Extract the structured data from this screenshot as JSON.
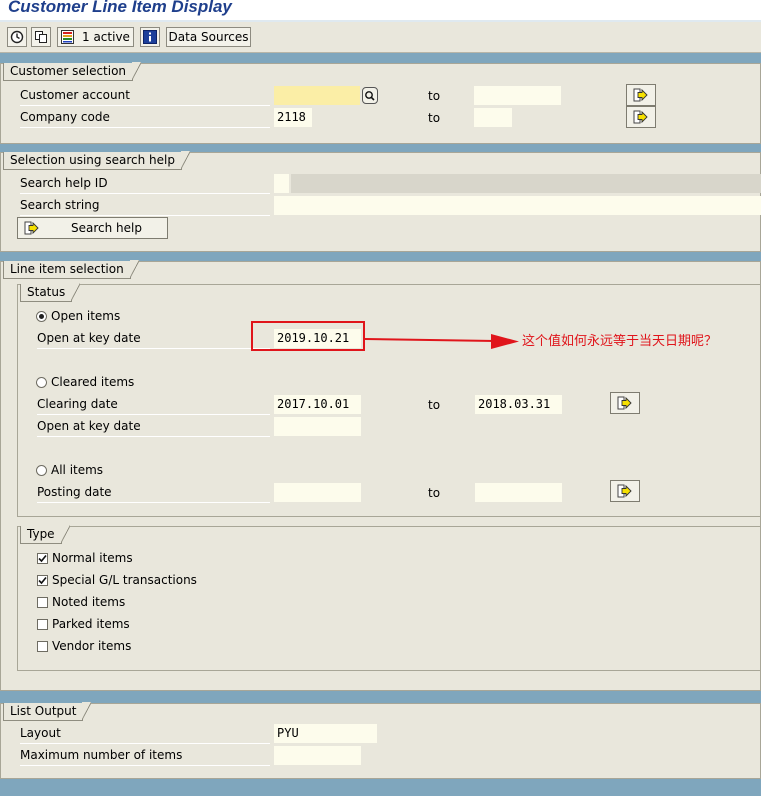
{
  "window": {
    "title": "Customer Line Item Display"
  },
  "toolbar": {
    "execute_icon": "clock-execute-icon",
    "variant_icon": "copy-variant-icon",
    "dynamic_selections_label": "1  active",
    "info_icon": "info-icon",
    "data_sources_label": "Data Sources"
  },
  "customer_selection": {
    "title": "Customer selection",
    "customer_account_label": "Customer account",
    "customer_account_value": "",
    "to_label": "to",
    "customer_account_to": "",
    "company_code_label": "Company code",
    "company_code_value": "2118",
    "company_code_to": ""
  },
  "search_help": {
    "title": "Selection using search help",
    "search_help_id_label": "Search help ID",
    "search_string_label": "Search string",
    "button_label": "Search help"
  },
  "line_item_selection": {
    "title": "Line item selection",
    "status": {
      "title": "Status",
      "open_items_label": "Open items",
      "open_at_key_date_label": "Open at key date",
      "open_at_key_date_value": "2019.10.21",
      "cleared_items_label": "Cleared items",
      "clearing_date_label": "Clearing date",
      "clearing_date_from": "2017.10.01",
      "to_label": "to",
      "clearing_date_to": "2018.03.31",
      "cleared_open_at_key_date_label": "Open at key date",
      "cleared_open_at_key_date_value": "",
      "all_items_label": "All items",
      "posting_date_label": "Posting date",
      "posting_date_from": "",
      "posting_date_to": "",
      "selected": "open_items"
    },
    "type": {
      "title": "Type",
      "items": [
        {
          "label": "Normal items",
          "checked": true
        },
        {
          "label": "Special G/L transactions",
          "checked": true
        },
        {
          "label": "Noted items",
          "checked": false
        },
        {
          "label": "Parked items",
          "checked": false
        },
        {
          "label": "Vendor items",
          "checked": false
        }
      ]
    }
  },
  "list_output": {
    "title": "List Output",
    "layout_label": "Layout",
    "layout_value": "PYU",
    "max_items_label": "Maximum number of items",
    "max_items_value": ""
  },
  "annotation": {
    "text": "这个值如何永远等于当天日期呢？",
    "color": "#e0151b"
  },
  "colors": {
    "required_field": "#fbeea6",
    "field": "#fdfcec",
    "group_bg": "#e9e7dc",
    "band": "#7fa6bd"
  }
}
